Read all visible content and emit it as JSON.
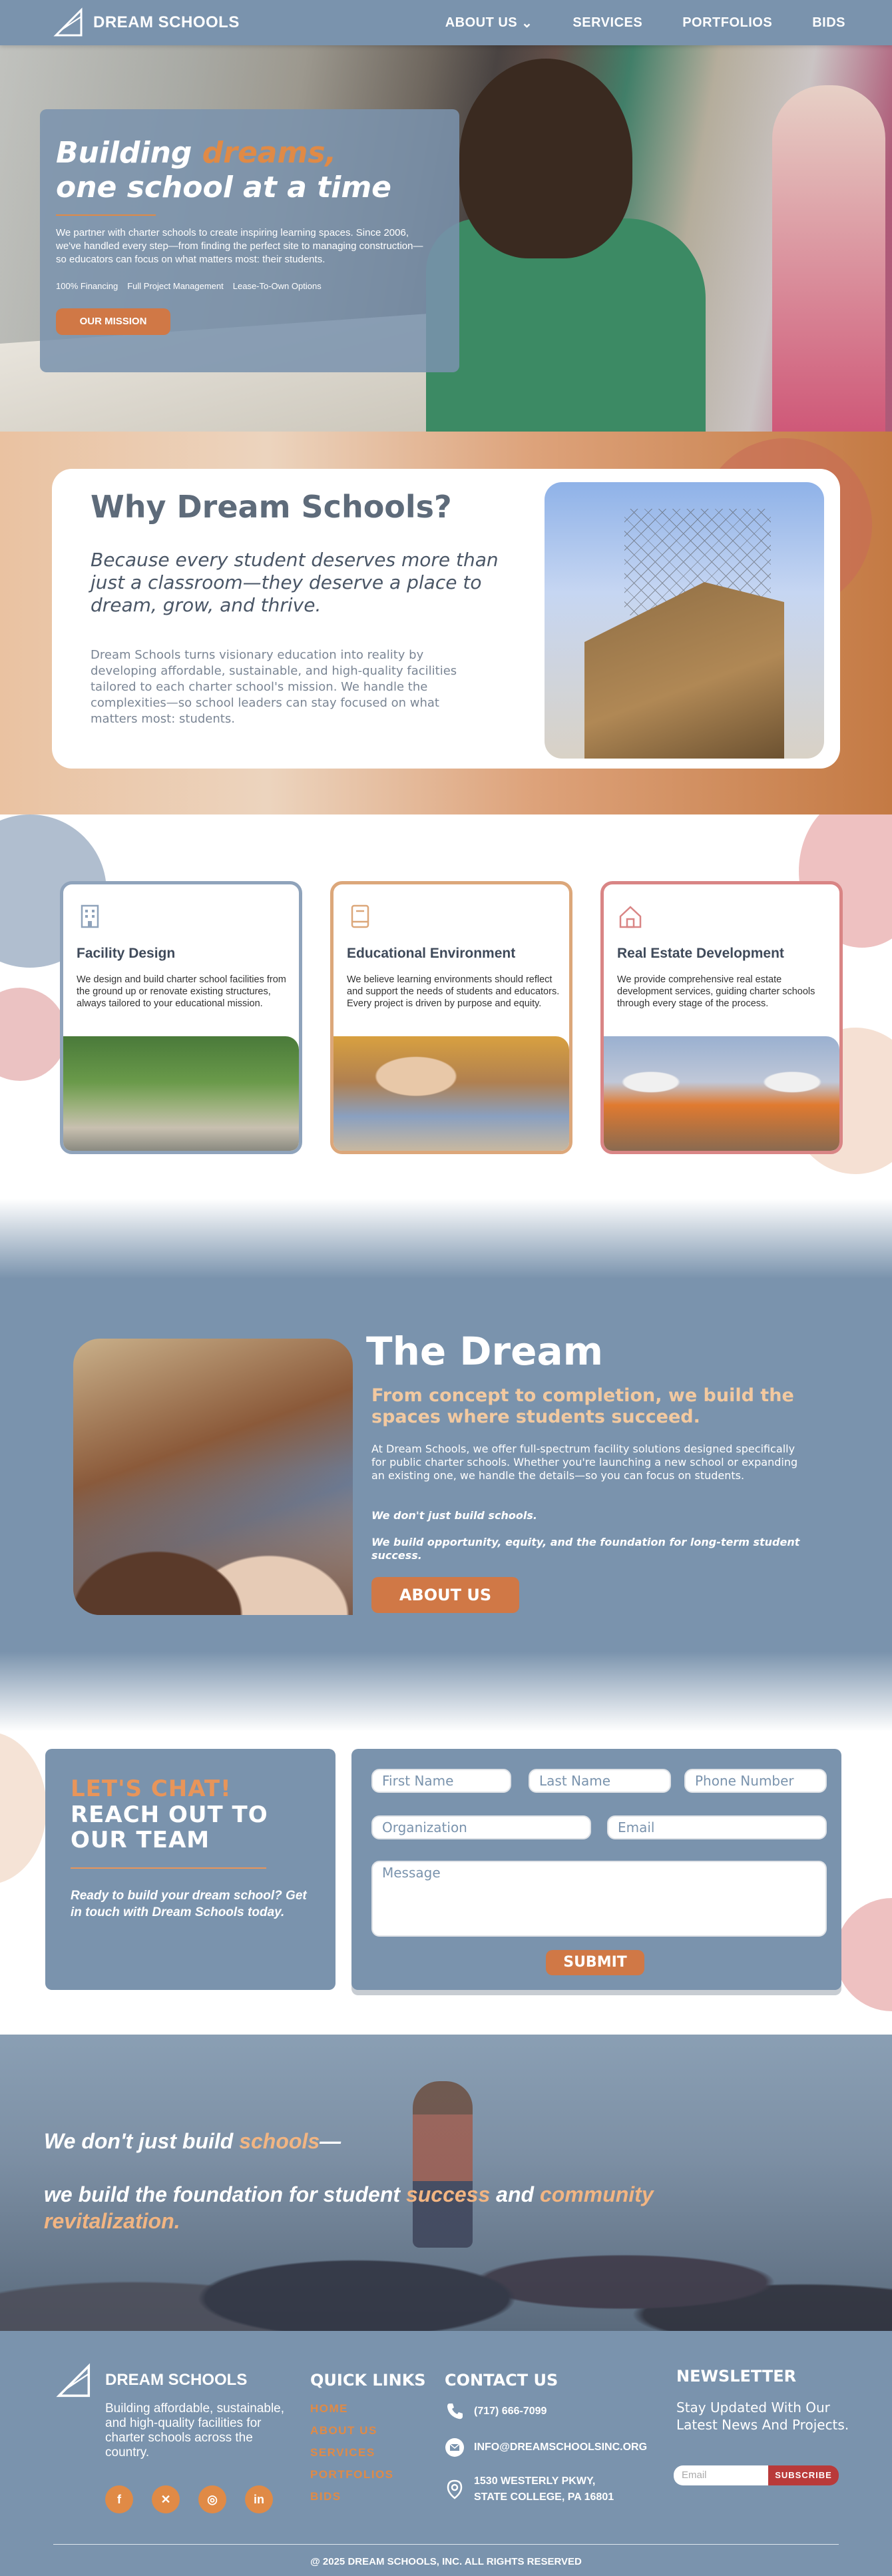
{
  "nav": {
    "brand": "DREAM SCHOOLS",
    "links": [
      "ABOUT US",
      "SERVICES",
      "PORTFOLIOS",
      "BIDS"
    ]
  },
  "hero": {
    "title_part1": "Building ",
    "title_accent": "dreams,",
    "title_line2": "one school at a time",
    "body": "We partner with charter schools to create inspiring learning spaces. Since 2006, we've handled every step—from finding the perfect site to managing construction—so educators can focus on what matters most: their students.",
    "features": [
      "100% Financing",
      "Full Project Management",
      "Lease-To-Own Options"
    ],
    "cta": "OUR MISSION"
  },
  "why": {
    "title": "Why Dream Schools?",
    "subtitle": "Because every student deserves more than just a classroom—they deserve a place to dream, grow, and thrive.",
    "body": "Dream Schools turns visionary education into reality by developing affordable, sustainable, and high-quality facilities tailored to each charter school's mission. We handle the complexities—so school leaders can stay focused on what matters most: students."
  },
  "services": [
    {
      "title": "Facility Design",
      "icon": "building-icon",
      "color": "#8fa3bb",
      "text": "We design and build charter school facilities from the ground up or renovate existing structures, always tailored to your educational mission."
    },
    {
      "title": "Educational Environment",
      "icon": "book-icon",
      "color": "#dca77a",
      "text": "We believe learning environments should reflect and support the needs of students and educators. Every project is driven by purpose and equity."
    },
    {
      "title": "Real Estate Development",
      "icon": "home-icon",
      "color": "#d98585",
      "text": "We provide comprehensive real estate development services, guiding charter schools through every stage of the process."
    }
  ],
  "dream": {
    "title": "The Dream",
    "tagline": "From concept to completion, we build the spaces where students succeed.",
    "body": "At Dream Schools, we offer full-spectrum facility solutions designed specifically for public charter schools. Whether you're launching a new school or expanding an existing one, we handle the details—so you can focus on students.",
    "italic1": "We don't just build schools.",
    "italic2": "We build opportunity, equity, and the foundation for long-term student success.",
    "cta": "ABOUT US"
  },
  "contact": {
    "lets_chat": "LET'S CHAT!",
    "reach_line1": "REACH OUT TO",
    "reach_line2": "OUR TEAM",
    "prompt": "Ready to build your dream school? Get in touch with Dream Schools today.",
    "placeholders": {
      "first": "First Name",
      "last": "Last Name",
      "phone": "Phone Number",
      "org": "Organization",
      "email": "Email",
      "message": "Message"
    },
    "submit": "SUBMIT"
  },
  "banner": {
    "l1_a": "We don't just build ",
    "l1_b": "schools",
    "l1_c": "—",
    "l2_a": "we build the foundation for student ",
    "l2_b": "success",
    "l2_c": " and ",
    "l2_d": "community revitalization."
  },
  "footer": {
    "brand": "DREAM SCHOOLS",
    "desc": "Building affordable, sustainable, and high-quality facilities for charter schools across the country.",
    "social": [
      "facebook-icon",
      "x-icon",
      "instagram-icon",
      "linkedin-icon"
    ],
    "quick_links_title": "QUICK LINKS",
    "quick_links": [
      "HOME",
      "ABOUT US",
      "SERVICES",
      "PORTFOLIOS",
      "BIDS"
    ],
    "contact_title": "CONTACT US",
    "phone": "(717) 666-7099",
    "email": "INFO@DREAMSCHOOLSINC.ORG",
    "address_line1": "1530 WESTERLY PKWY,",
    "address_line2": "STATE COLLEGE, PA 16801",
    "newsletter_title": "NEWSLETTER",
    "newsletter_text": "Stay Updated With Our Latest News And Projects.",
    "email_placeholder": "Email",
    "subscribe": "SUBSCRIBE",
    "copyright": "@ 2025 DREAM SCHOOLS, INC. ALL RIGHTS RESERVED"
  },
  "colors": {
    "primary": "#7a93ad",
    "accent": "#e08a46",
    "footer_button": "#b93a3a"
  }
}
